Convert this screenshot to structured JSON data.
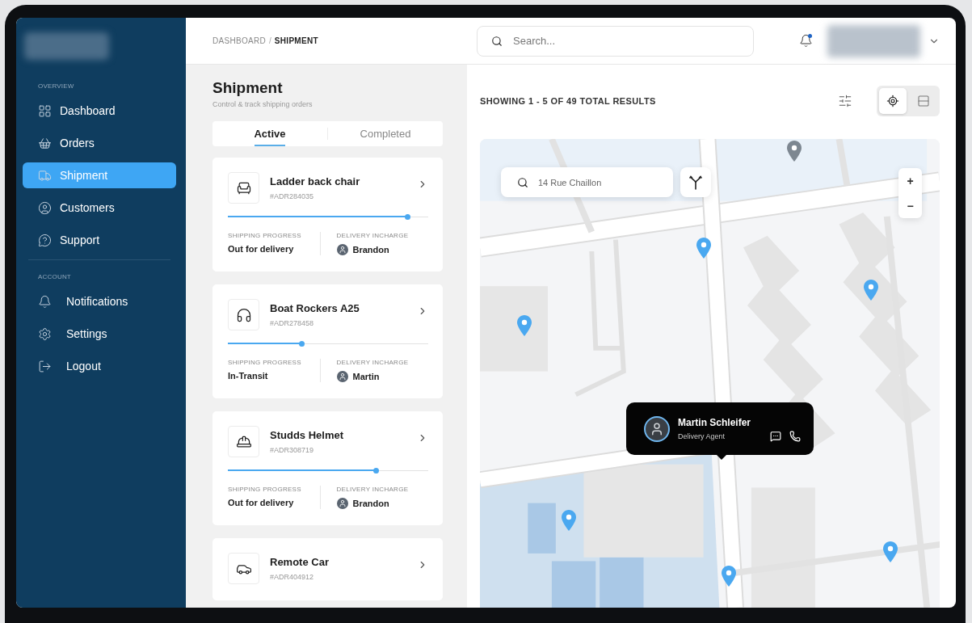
{
  "breadcrumb_separator": "/",
  "breadcrumb": [
    {
      "label": "DASHBOARD",
      "selected": false
    },
    {
      "label": "SHIPMENT",
      "selected": true
    }
  ],
  "search": {
    "placeholder": "Search..."
  },
  "notifications": {
    "unread": true
  },
  "sidebar": {
    "sections": [
      {
        "title": "OVERVIEW",
        "items": [
          {
            "label": "Dashboard",
            "kind": "grid",
            "selected": false
          },
          {
            "label": "Orders",
            "kind": "basket",
            "selected": false
          },
          {
            "label": "Shipment",
            "kind": "truck",
            "selected": true
          },
          {
            "label": "Customers",
            "kind": "user",
            "selected": false
          },
          {
            "label": "Support",
            "kind": "help",
            "selected": false
          }
        ]
      },
      {
        "title": "ACCOUNT",
        "items": [
          {
            "label": "Notifications",
            "kind": "bell",
            "selected": false
          },
          {
            "label": "Settings",
            "kind": "gear",
            "selected": false
          },
          {
            "label": "Logout",
            "kind": "logout",
            "selected": false
          }
        ]
      }
    ]
  },
  "page": {
    "title": "Shipment",
    "subtitle": "Control & track shipping orders"
  },
  "tabs": [
    {
      "label": "Active",
      "selected": true
    },
    {
      "label": "Completed",
      "selected": false
    }
  ],
  "shipments": [
    {
      "name": "Ladder back chair",
      "id": "#ADR284035",
      "kind": "chair",
      "level": 0.9,
      "progress_label": "SHIPPING PROGRESS",
      "status": "Out for delivery",
      "agent_label": "DELIVERY INCHARGE",
      "agent": "Brandon"
    },
    {
      "name": "Boat Rockers A25",
      "id": "#ADR278458",
      "kind": "headphones",
      "level": 0.37,
      "progress_label": "SHIPPING PROGRESS",
      "status": "In-Transit",
      "agent_label": "DELIVERY INCHARGE",
      "agent": "Martin"
    },
    {
      "name": "Studds Helmet",
      "id": "#ADR308719",
      "kind": "helmet",
      "level": 0.74,
      "progress_label": "SHIPPING PROGRESS",
      "status": "Out for delivery",
      "agent_label": "DELIVERY INCHARGE",
      "agent": "Brandon"
    },
    {
      "name": "Remote Car",
      "id": "#ADR404912",
      "kind": "car"
    }
  ],
  "results": {
    "summary": "SHOWING 1 - 5 OF  49 TOTAL RESULTS"
  },
  "view_toggle": [
    {
      "kind": "map",
      "selected": true
    },
    {
      "kind": "list",
      "selected": false
    }
  ],
  "map": {
    "search": {
      "value": "14 Rue Chaillon"
    },
    "zoom": [
      "+",
      "−"
    ],
    "agent": {
      "name": "Martin Schleifer",
      "role": "Delivery Agent"
    }
  }
}
